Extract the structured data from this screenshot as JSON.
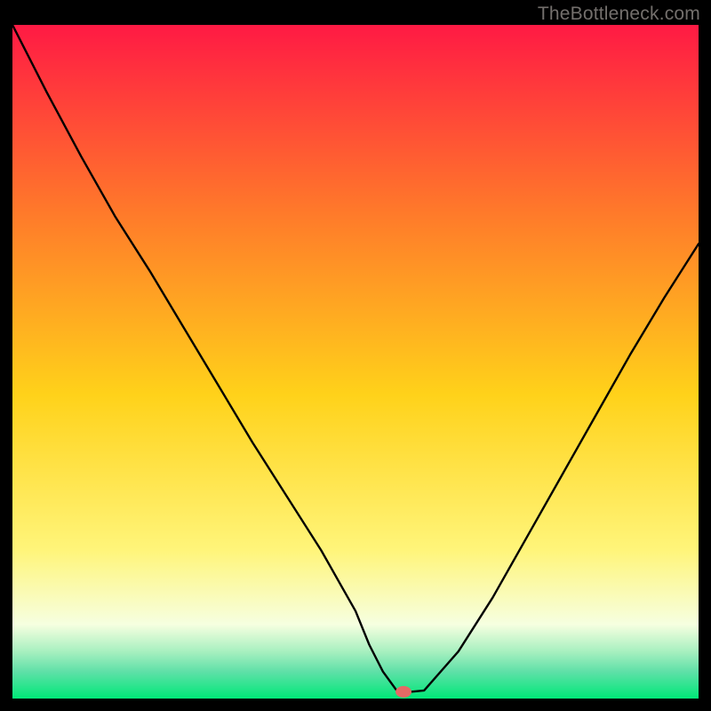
{
  "watermark": "TheBottleneck.com",
  "colors": {
    "top": "#ff1a44",
    "upper_mid": "#ff7a2a",
    "mid": "#ffd21a",
    "low_yellow": "#fff57a",
    "pale": "#f6ffe0",
    "teal_band1": "#a8f0c0",
    "teal_band2": "#5fe0a8",
    "bottom": "#00e878",
    "curve": "#000000",
    "marker": "#e46a65",
    "axis": "#000000"
  },
  "chart_data": {
    "type": "line",
    "title": "",
    "xlabel": "",
    "ylabel": "",
    "xlim": [
      0,
      100
    ],
    "ylim": [
      0,
      100
    ],
    "series": [
      {
        "name": "bottleneck-curve",
        "x": [
          0,
          5,
          10,
          15,
          20,
          25,
          30,
          35,
          40,
          45,
          50,
          52,
          54,
          56,
          58,
          60,
          65,
          70,
          75,
          80,
          85,
          90,
          95,
          100
        ],
        "y": [
          100,
          90,
          80.5,
          71.5,
          63.5,
          55,
          46.5,
          38,
          30,
          22,
          13,
          8,
          4,
          1.2,
          1.0,
          1.2,
          7,
          15,
          24,
          33,
          42,
          51,
          59.5,
          67.5
        ]
      }
    ],
    "marker": {
      "x": 57,
      "y": 1.0
    },
    "gradient_stops": [
      {
        "pct": 0,
        "color": "#ff1a44"
      },
      {
        "pct": 28,
        "color": "#ff7a2a"
      },
      {
        "pct": 55,
        "color": "#ffd21a"
      },
      {
        "pct": 78,
        "color": "#fff57a"
      },
      {
        "pct": 89,
        "color": "#f6ffe0"
      },
      {
        "pct": 93,
        "color": "#a8f0c0"
      },
      {
        "pct": 96,
        "color": "#5fe0a8"
      },
      {
        "pct": 100,
        "color": "#00e878"
      }
    ]
  }
}
